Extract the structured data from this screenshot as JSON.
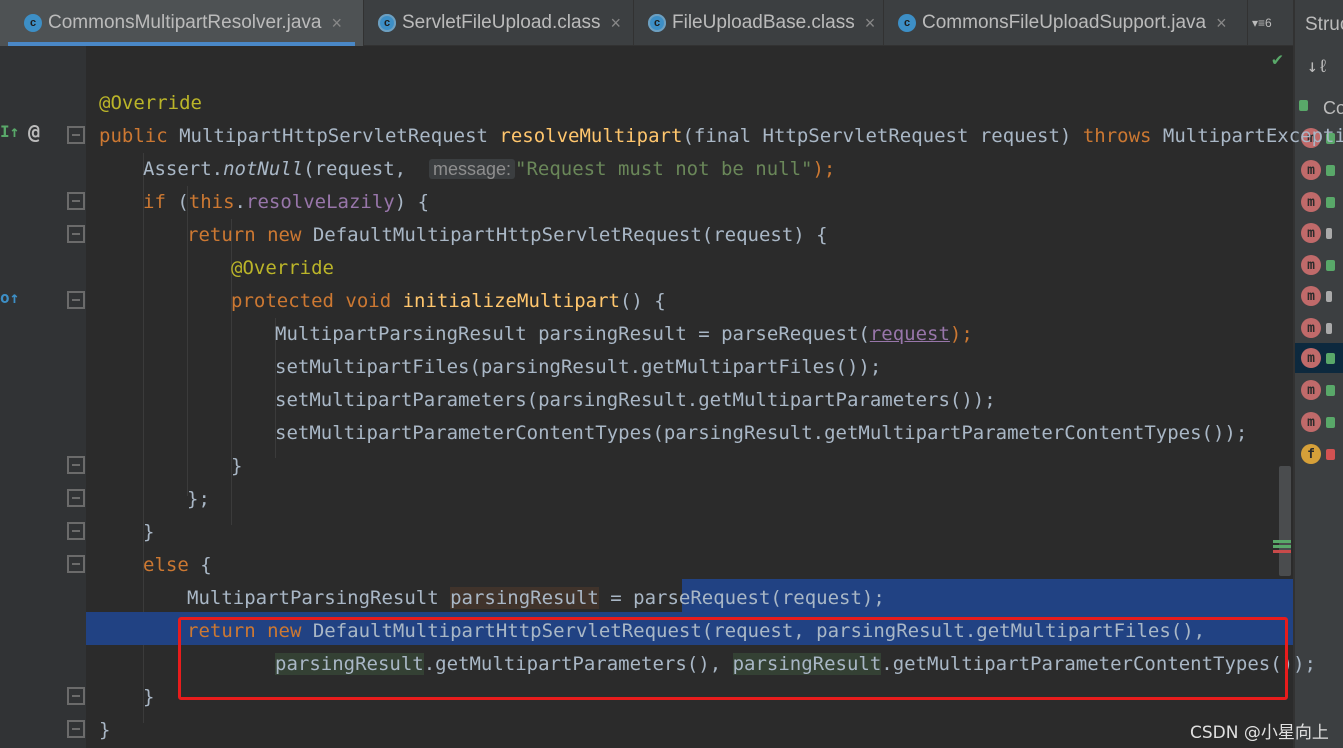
{
  "tabs": [
    {
      "label": "CommonsMultipartResolver.java",
      "icon": "class-icon",
      "active": true
    },
    {
      "label": "ServletFileUpload.class",
      "icon": "compiled-class-icon"
    },
    {
      "label": "FileUploadBase.class",
      "icon": "compiled-class-icon"
    },
    {
      "label": "CommonsFileUploadSupport.java",
      "icon": "class-icon"
    }
  ],
  "tab_overflow": "6",
  "structure_panel": {
    "title": "Struc",
    "root": "Co",
    "selected_index": 7,
    "items": [
      "m",
      "m",
      "m",
      "m",
      "m",
      "m",
      "m",
      "m",
      "m",
      "m",
      "f"
    ]
  },
  "watermark": "CSDN @小星向上",
  "code": {
    "l1": "@Override",
    "l2_kw": "public",
    "l2_type": "MultipartHttpServletRequest",
    "l2_fn": "resolveMultipart",
    "l2_rest": "(final HttpServletRequest request) ",
    "l2_throws": "throws",
    "l2_exc": " MultipartExcepti",
    "l3_a": "Assert.",
    "l3_fn": "notNull",
    "l3_b": "(request,  ",
    "l3_hint": "message:",
    "l3_str": "\"Request must not be null\"",
    "l3_end": ");",
    "l4_if": "if",
    "l4_a": " (",
    "l4_this": "this",
    "l4_b": ".",
    "l4_field": "resolveLazily",
    "l4_c": ") {",
    "l5_return": "return",
    "l5_new": " new",
    "l5_rest": " DefaultMultipartHttpServletRequest(request) {",
    "l6": "@Override",
    "l7_prot": "protected",
    "l7_void": " void",
    "l7_fn": "initializeMultipart",
    "l7_rest": "() {",
    "l8_a": "MultipartParsingResult parsingResult = parseRequest(",
    "l8_req": "request",
    "l8_end": ");",
    "l9": "setMultipartFiles(parsingResult.getMultipartFiles());",
    "l10": "setMultipartParameters(parsingResult.getMultipartParameters());",
    "l11": "setMultipartParameterContentTypes(parsingResult.getMultipartParameterContentTypes());",
    "l12": "}",
    "l13": "};",
    "l14": "}",
    "l15_else": "else",
    "l15_rest": " {",
    "l16_a": "MultipartParsingResult ",
    "l16_var": "parsingResult",
    "l16_b": " = parseRequest(request);",
    "l17_return": "return",
    "l17_new": " new",
    "l17_rest": " DefaultMultipartHttpServletRequest(request, parsingResult.getMultipartFiles(),",
    "l18_v1": "parsingResult",
    "l18_a": ".getMultipartParameters(), ",
    "l18_v2": "parsingResult",
    "l18_b": ".getMultipartParameterContentTypes());",
    "l19": "}",
    "l20": "}"
  }
}
